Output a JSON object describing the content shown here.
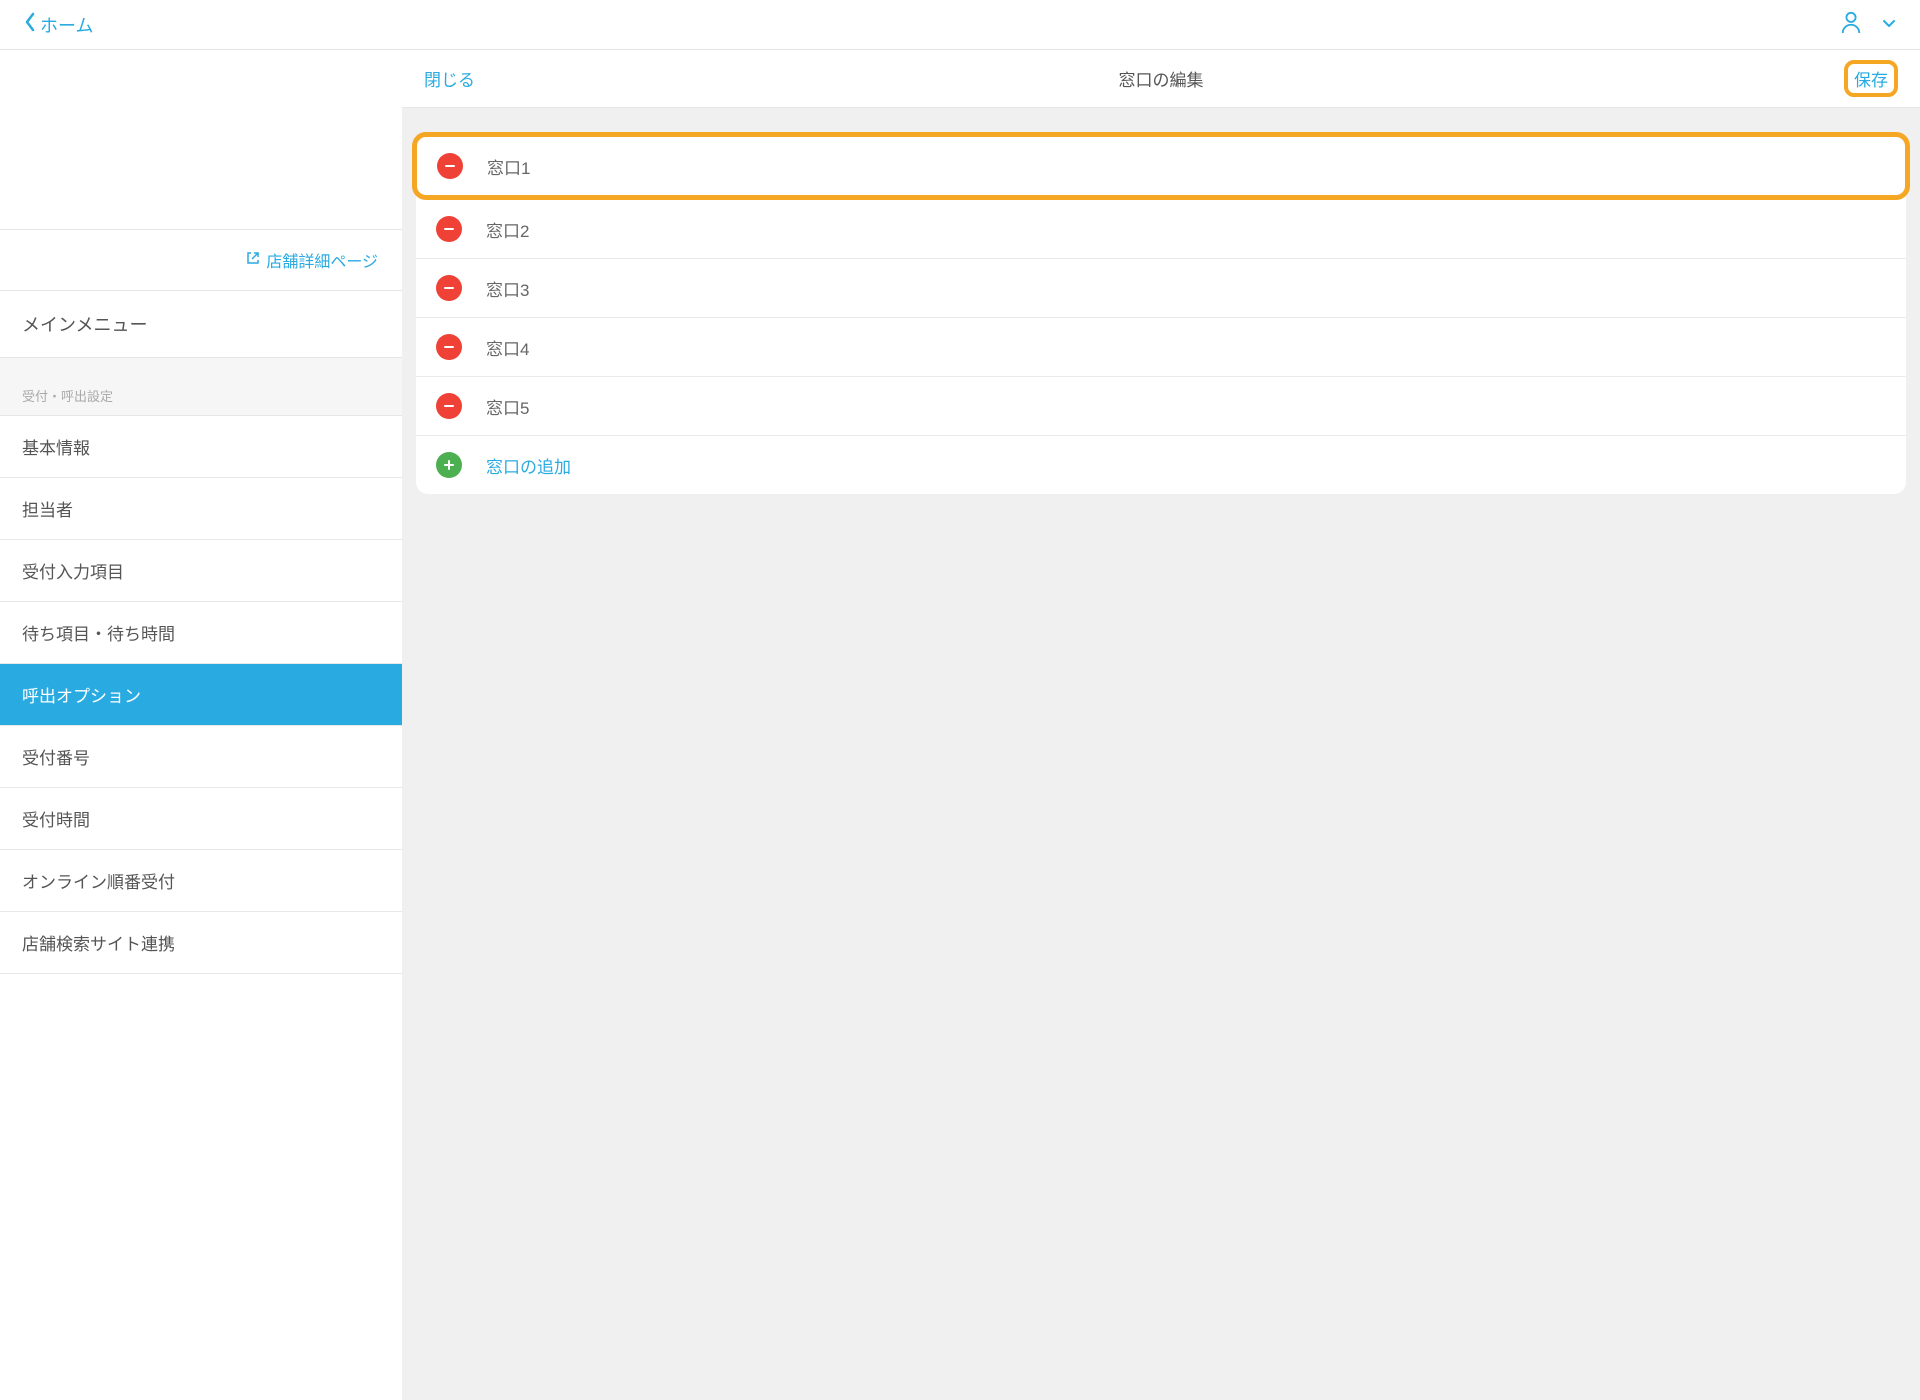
{
  "topbar": {
    "back_label": "ホーム"
  },
  "sidebar": {
    "store_link": "店舗詳細ページ",
    "main_menu": "メインメニュー",
    "section_header": "受付・呼出設定",
    "items": [
      {
        "label": "基本情報",
        "active": false
      },
      {
        "label": "担当者",
        "active": false
      },
      {
        "label": "受付入力項目",
        "active": false
      },
      {
        "label": "待ち項目・待ち時間",
        "active": false
      },
      {
        "label": "呼出オプション",
        "active": true
      },
      {
        "label": "受付番号",
        "active": false
      },
      {
        "label": "受付時間",
        "active": false
      },
      {
        "label": "オンライン順番受付",
        "active": false
      },
      {
        "label": "店舗検索サイト連携",
        "active": false
      }
    ]
  },
  "panel": {
    "close": "閉じる",
    "title": "窓口の編集",
    "save": "保存"
  },
  "windows": {
    "items": [
      {
        "label": "窓口1",
        "highlighted": true
      },
      {
        "label": "窓口2",
        "highlighted": false
      },
      {
        "label": "窓口3",
        "highlighted": false
      },
      {
        "label": "窓口4",
        "highlighted": false
      },
      {
        "label": "窓口5",
        "highlighted": false
      }
    ],
    "add_label": "窓口の追加"
  }
}
